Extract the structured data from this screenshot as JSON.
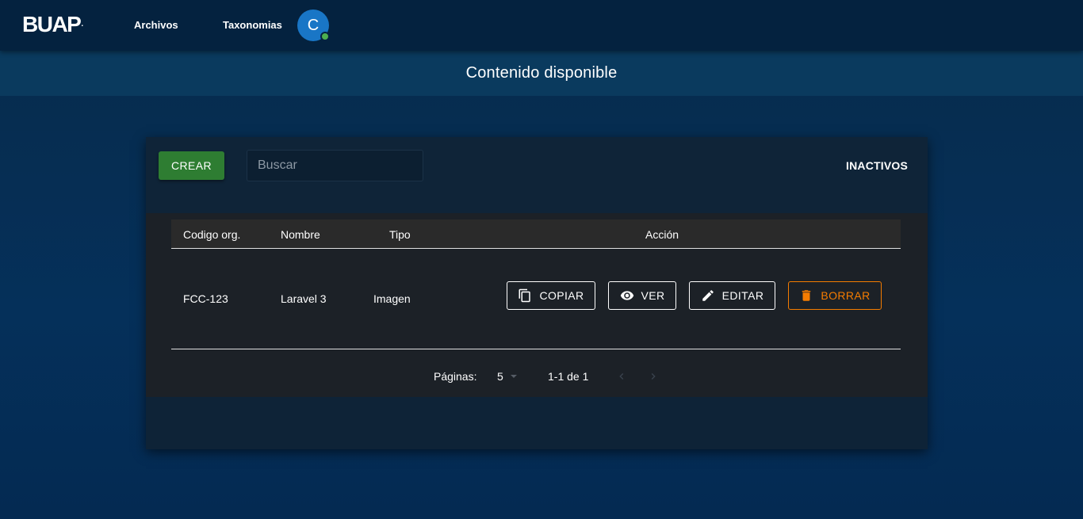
{
  "header": {
    "logo": "BUAP",
    "logo_dot": ".",
    "nav": [
      {
        "label": "Archivos"
      },
      {
        "label": "Taxonomias"
      }
    ],
    "avatar_initial": "C",
    "status_color": "#4caf50"
  },
  "page": {
    "title": "Contenido disponible"
  },
  "toolbar": {
    "create_label": "CREAR",
    "search_placeholder": "Buscar",
    "inactive_label": "INACTIVOS"
  },
  "table": {
    "columns": [
      "Codigo org.",
      "Nombre",
      "Tipo",
      "Acción"
    ],
    "rows": [
      {
        "codigo": "FCC-123",
        "nombre": "Laravel 3",
        "tipo": "Imagen"
      }
    ],
    "actions": {
      "copy": "COPIAR",
      "view": "VER",
      "edit": "EDITAR",
      "delete": "BORRAR"
    }
  },
  "pagination": {
    "label": "Páginas:",
    "per_page": "5",
    "range": "1-1 de 1"
  },
  "colors": {
    "create_button": "#2e7d32",
    "delete_button": "#f57c00",
    "avatar": "#1976c6"
  },
  "icons": {
    "copy": "copy-icon",
    "view": "eye-icon",
    "edit": "pencil-icon",
    "delete": "trash-icon",
    "prev": "chevron-left-icon",
    "next": "chevron-right-icon"
  }
}
